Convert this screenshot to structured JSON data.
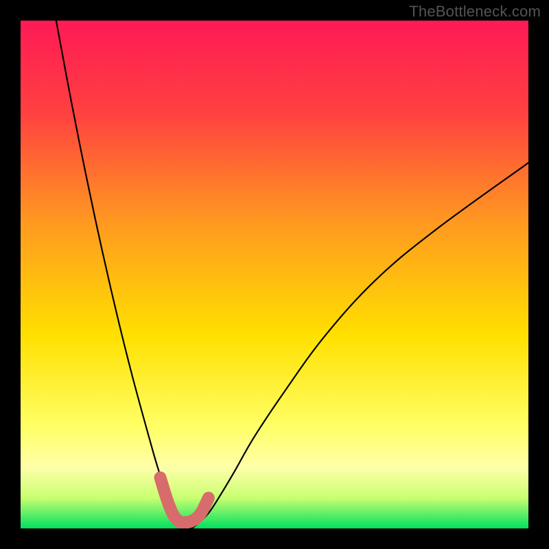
{
  "watermark": "TheBottleneck.com",
  "chart_data": {
    "type": "line",
    "title": "",
    "xlabel": "",
    "ylabel": "",
    "xlim": [
      0,
      100
    ],
    "ylim": [
      0,
      100
    ],
    "grid": false,
    "gradient_stops": [
      {
        "offset": 0.0,
        "color": "#ff1a55"
      },
      {
        "offset": 0.18,
        "color": "#ff4040"
      },
      {
        "offset": 0.4,
        "color": "#ff9a20"
      },
      {
        "offset": 0.62,
        "color": "#ffe000"
      },
      {
        "offset": 0.8,
        "color": "#ffff66"
      },
      {
        "offset": 0.88,
        "color": "#ffffaa"
      },
      {
        "offset": 0.94,
        "color": "#c8ff70"
      },
      {
        "offset": 1.0,
        "color": "#00e060"
      }
    ],
    "series": [
      {
        "name": "bottleneck-curve",
        "color": "#000000",
        "x": [
          7,
          10,
          13,
          16,
          19,
          22,
          25,
          27,
          29,
          30.5,
          32,
          33.5,
          35,
          37,
          39,
          42,
          46,
          52,
          60,
          70,
          82,
          100
        ],
        "y": [
          100,
          84,
          69,
          55,
          42,
          30,
          19,
          12,
          6,
          2,
          0,
          0,
          1,
          3,
          6,
          11,
          18,
          27,
          38,
          49,
          59,
          72
        ]
      }
    ],
    "marker_band": {
      "name": "optimal-region",
      "color": "#d86b6b",
      "x": [
        27.5,
        28.8,
        30.0,
        31.2,
        32.5,
        34.0,
        35.5,
        37.0
      ],
      "y": [
        10.0,
        5.8,
        2.8,
        1.4,
        1.2,
        1.6,
        3.0,
        6.0
      ]
    }
  }
}
